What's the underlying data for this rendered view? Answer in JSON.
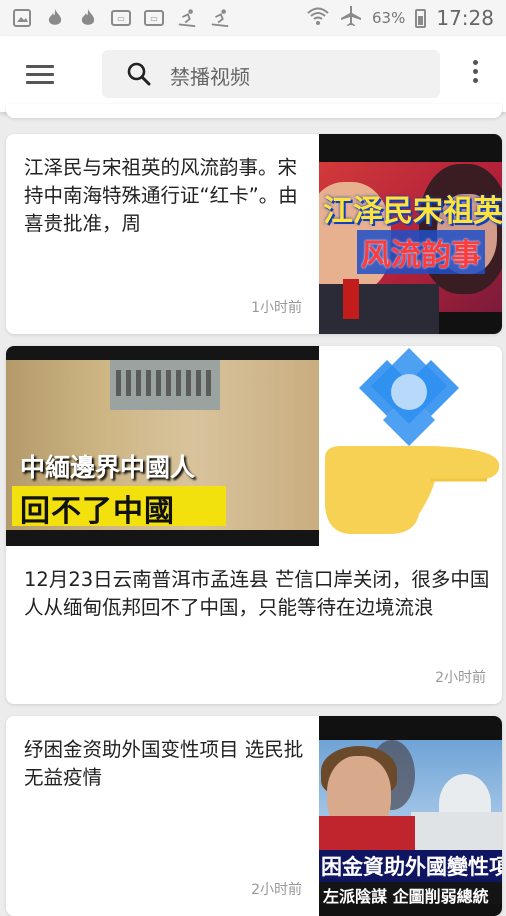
{
  "status_bar": {
    "battery_percent": "63%",
    "time": "17:28",
    "left_icons": [
      "image-icon",
      "flame-icon",
      "flame-icon",
      "notification-box-icon",
      "notification-box-icon",
      "skier-icon",
      "skier-icon"
    ],
    "right_icons": [
      "wifi-icon",
      "airplane-mode-icon",
      "battery-icon"
    ]
  },
  "app_bar": {
    "search_placeholder": "禁播视频",
    "menu_icon": "hamburger-menu-icon",
    "more_icon": "more-vertical-icon"
  },
  "feed": [
    {
      "title": "江泽民与宋祖英的风流韵事。宋持中南海特殊通行证“红卡”。由喜贵批准，周",
      "time": "1小时前",
      "thumb_caption_1": "江泽民宋祖英",
      "thumb_caption_2": "风流韵事"
    },
    {
      "title": "12月23日云南普洱市孟连县 芒信口岸关闭，很多中国人从缅甸佤邦回不了中国，只能等待在边境流浪",
      "time": "2小时前",
      "thumb_caption_1": "中緬邊界中國人",
      "thumb_caption_2": "回不了中國"
    },
    {
      "title": "纾困金资助外国变性项目 选民批无益疫情",
      "time": "2小时前",
      "thumb_caption_1": "困金資助外國變性項",
      "thumb_caption_2": "左派陰謀 企圖削弱總統"
    }
  ],
  "colors": {
    "background": "#ececec",
    "card": "#ffffff",
    "brand_blue": "#2f8ff0",
    "pointer_yellow": "#f7d154"
  }
}
